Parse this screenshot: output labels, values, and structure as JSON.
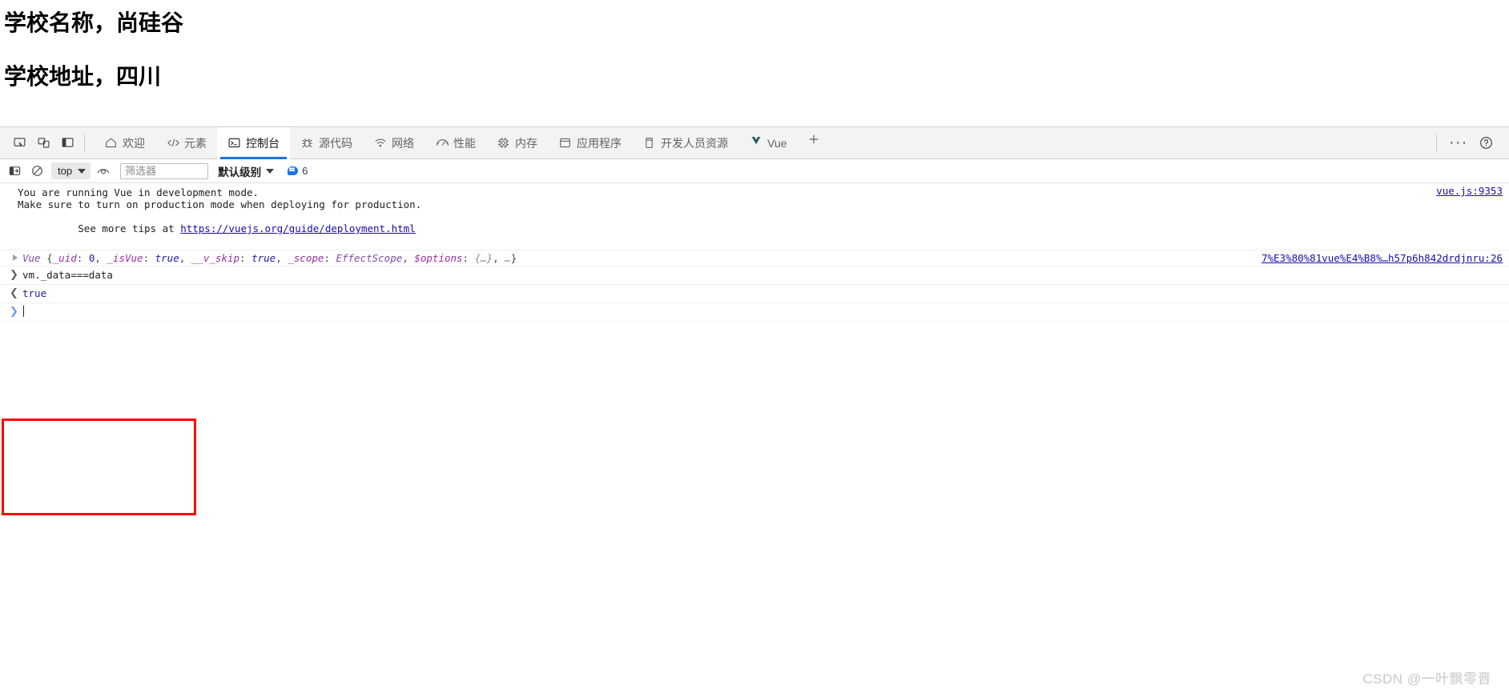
{
  "page": {
    "headings": [
      "学校名称，尚硅谷",
      "学校地址，四川"
    ]
  },
  "devtools": {
    "left_tools": [
      {
        "name": "inspect-element-icon",
        "title": "检查元素"
      },
      {
        "name": "device-toolbar-icon",
        "title": "设备工具栏"
      },
      {
        "name": "dock-side-icon",
        "title": "停靠位置"
      }
    ],
    "tabs": [
      {
        "label": "欢迎",
        "icon": "home-icon",
        "active": false
      },
      {
        "label": "元素",
        "icon": "code-icon",
        "active": false
      },
      {
        "label": "控制台",
        "icon": "console-icon",
        "active": true
      },
      {
        "label": "源代码",
        "icon": "bug-icon",
        "active": false
      },
      {
        "label": "网络",
        "icon": "wifi-icon",
        "active": false
      },
      {
        "label": "性能",
        "icon": "gauge-icon",
        "active": false
      },
      {
        "label": "内存",
        "icon": "memory-chip-icon",
        "active": false
      },
      {
        "label": "应用程序",
        "icon": "application-window-icon",
        "active": false
      },
      {
        "label": "开发人员资源",
        "icon": "device-resources-icon",
        "active": false
      },
      {
        "label": "Vue",
        "icon": "vue-logo-icon",
        "active": false
      }
    ],
    "add_tab_label": "+",
    "more_options_label": "···",
    "help_label": "?",
    "accent_color": "#1a73e8"
  },
  "console_toolbar": {
    "sidebar_toggle": "console-sidebar-icon",
    "clear_console": "clear-console-icon",
    "context_value": "top",
    "live_expression": "eye-icon",
    "filter_placeholder": "筛选器",
    "filter_value": "",
    "level_label": "默认级别",
    "info_count": "6"
  },
  "console": {
    "messages": [
      {
        "type": "vue-warn",
        "lines": [
          "You are running Vue in development mode.",
          "Make sure to turn on production mode when deploying for production.",
          "See more tips at "
        ],
        "link_text": "https://vuejs.org/guide/deployment.html",
        "source": "vue.js:9353"
      },
      {
        "type": "object",
        "constructor": "Vue",
        "props": [
          {
            "key": "_uid",
            "value": "0",
            "kind": "number"
          },
          {
            "key": "_isVue",
            "value": "true",
            "kind": "boolean"
          },
          {
            "key": "__v_skip",
            "value": "true",
            "kind": "boolean"
          },
          {
            "key": "_scope",
            "value": "EffectScope",
            "kind": "class"
          },
          {
            "key": "$options",
            "value": "{…}",
            "kind": "object"
          }
        ],
        "ellipsis": "…",
        "source": "7%E3%80%81vue%E4%B8%…h57p6h842drdjnru:26"
      }
    ],
    "input_expression": "vm._data===data",
    "result_value": "true",
    "prompt_glyph": "❯",
    "return_glyph": "❮",
    "current_input": ""
  },
  "annotation": {
    "box_color": "#ff0000"
  },
  "watermark": {
    "text": "CSDN @一叶飘零晋"
  }
}
